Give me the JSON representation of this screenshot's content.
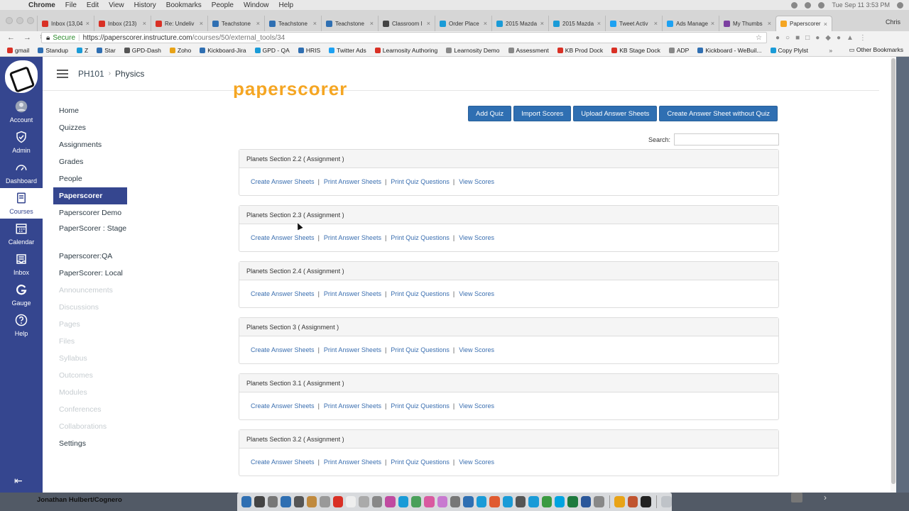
{
  "menubar": {
    "app": "Chrome",
    "items": [
      "File",
      "Edit",
      "View",
      "History",
      "Bookmarks",
      "People",
      "Window",
      "Help"
    ],
    "clock": "Tue Sep 11  3:53 PM"
  },
  "tabs": [
    {
      "label": "Inbox (13,04",
      "color": "#d93025"
    },
    {
      "label": "Inbox (213)",
      "color": "#d93025"
    },
    {
      "label": "Re: Undeliv",
      "color": "#d93025"
    },
    {
      "label": "Teachstone",
      "color": "#2f6fb2"
    },
    {
      "label": "Teachstone",
      "color": "#2f6fb2"
    },
    {
      "label": "Teachstone",
      "color": "#2f6fb2"
    },
    {
      "label": "Classroom I",
      "color": "#444444"
    },
    {
      "label": "Order Place",
      "color": "#1a9bd7"
    },
    {
      "label": "2015 Mazda",
      "color": "#1a9bd7"
    },
    {
      "label": "2015 Mazda",
      "color": "#1a9bd7"
    },
    {
      "label": "Tweet Activ",
      "color": "#1da1f2"
    },
    {
      "label": "Ads Manage",
      "color": "#1da1f2"
    },
    {
      "label": "My Thumbs",
      "color": "#7b3fa0"
    },
    {
      "label": "Paperscorer",
      "color": "#f5a623"
    }
  ],
  "profile": "Chris",
  "address": {
    "secure": "Secure",
    "host": "https://paperscorer.instructure.com",
    "path": "/courses/50/external_tools/34"
  },
  "bookmarks": [
    {
      "label": "gmail",
      "color": "#d93025"
    },
    {
      "label": "Standup",
      "color": "#2f6fb2"
    },
    {
      "label": "Z",
      "color": "#1a9bd7"
    },
    {
      "label": "Star",
      "color": "#2f6fb2"
    },
    {
      "label": "GPD-Dash",
      "color": "#555555"
    },
    {
      "label": "Zoho",
      "color": "#e8a317"
    },
    {
      "label": "Kickboard-Jira",
      "color": "#2f6fb2"
    },
    {
      "label": "GPD - QA",
      "color": "#1a9bd7"
    },
    {
      "label": "HRIS",
      "color": "#2f6fb2"
    },
    {
      "label": "Twitter Ads",
      "color": "#1da1f2"
    },
    {
      "label": "Learnosity Authoring",
      "color": "#d93025"
    },
    {
      "label": "Learnosity Demo",
      "color": "#888888"
    },
    {
      "label": "Assessment",
      "color": "#888888"
    },
    {
      "label": "KB Prod Dock",
      "color": "#d93025"
    },
    {
      "label": "KB Stage Dock",
      "color": "#d93025"
    },
    {
      "label": "ADP",
      "color": "#888888"
    },
    {
      "label": "Kickboard - WeBuil...",
      "color": "#2f6fb2"
    },
    {
      "label": "Copy Plylst",
      "color": "#1a9bd7"
    }
  ],
  "other_bookmarks": "Other Bookmarks",
  "global_nav": [
    {
      "label": "Account",
      "icon": "user-avatar-icon"
    },
    {
      "label": "Admin",
      "icon": "shield-icon"
    },
    {
      "label": "Dashboard",
      "icon": "speedometer-icon"
    },
    {
      "label": "Courses",
      "icon": "book-icon",
      "active": true
    },
    {
      "label": "Calendar",
      "icon": "calendar-icon"
    },
    {
      "label": "Inbox",
      "icon": "inbox-icon"
    },
    {
      "label": "Gauge",
      "icon": "gauge-icon"
    },
    {
      "label": "Help",
      "icon": "question-icon"
    }
  ],
  "breadcrumb": {
    "course": "PH101",
    "section": "Physics"
  },
  "course_nav": [
    {
      "label": "Home",
      "state": "normal"
    },
    {
      "label": "Quizzes",
      "state": "normal"
    },
    {
      "label": "Assignments",
      "state": "normal"
    },
    {
      "label": "Grades",
      "state": "normal"
    },
    {
      "label": "People",
      "state": "normal"
    },
    {
      "label": "Paperscorer",
      "state": "active"
    },
    {
      "label": "Paperscorer Demo",
      "state": "normal"
    },
    {
      "label": "PaperScorer : Stage",
      "state": "normal",
      "two": true
    },
    {
      "label": "Paperscorer:QA",
      "state": "normal"
    },
    {
      "label": "PaperScorer: Local",
      "state": "normal"
    },
    {
      "label": "Announcements",
      "state": "dim"
    },
    {
      "label": "Discussions",
      "state": "dim"
    },
    {
      "label": "Pages",
      "state": "dim"
    },
    {
      "label": "Files",
      "state": "dim"
    },
    {
      "label": "Syllabus",
      "state": "dim"
    },
    {
      "label": "Outcomes",
      "state": "dim"
    },
    {
      "label": "Modules",
      "state": "dim"
    },
    {
      "label": "Conferences",
      "state": "dim"
    },
    {
      "label": "Collaborations",
      "state": "dim"
    },
    {
      "label": "Settings",
      "state": "normal"
    }
  ],
  "brand_peek": "paperscorer",
  "toolbar": {
    "add_quiz": "Add Quiz",
    "import_scores": "Import Scores",
    "upload": "Upload Answer Sheets",
    "create_without": "Create Answer Sheet without Quiz"
  },
  "search": {
    "label": "Search:",
    "value": ""
  },
  "link_labels": {
    "create": "Create Answer Sheets",
    "print": "Print Answer Sheets",
    "questions": "Print Quiz Questions",
    "scores": "View Scores",
    "separator": "|"
  },
  "assignments": [
    {
      "title": "Planets Section 2.2 ( Assignment )"
    },
    {
      "title": "Planets Section 2.3 ( Assignment )"
    },
    {
      "title": "Planets Section 2.4 ( Assignment )"
    },
    {
      "title": "Planets Section 3 ( Assignment )"
    },
    {
      "title": "Planets Section 3.1 ( Assignment )"
    },
    {
      "title": "Planets Section 3.2 ( Assignment )"
    }
  ],
  "taskbar_user": "Jonathan Hulbert/Cognero",
  "dock_colors": [
    "#2f6fb2",
    "#444444",
    "#777777",
    "#2f6fb2",
    "#555555",
    "#c08a3e",
    "#999999",
    "#d93025",
    "#eeeeee",
    "#aaaaaa",
    "#888888",
    "#c04aa0",
    "#1a9bd7",
    "#4aa05a",
    "#d95aa0",
    "#c87ad0",
    "#777777",
    "#2f6fb2",
    "#1a9bd7",
    "#e05a30",
    "#1a9bd7",
    "#555555",
    "#1a9bd7",
    "#3a9a40",
    "#00a3e0",
    "#1e7a3e",
    "#2b579a",
    "#888888",
    "#e8a317",
    "#c0542f",
    "#222222"
  ]
}
